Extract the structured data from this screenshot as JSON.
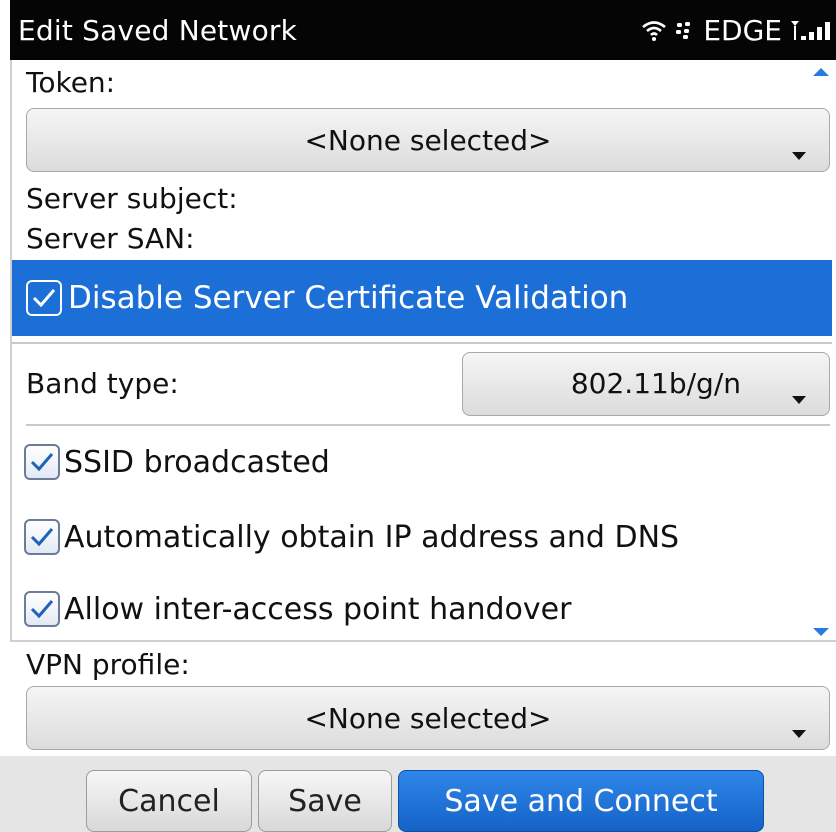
{
  "statusbar": {
    "title": "Edit Saved Network",
    "network": "EDGE",
    "icons": [
      "wifi-icon",
      "blackberry-icon",
      "signal-strength-icon"
    ]
  },
  "token": {
    "label": "Token:",
    "value": "<None selected>"
  },
  "server": {
    "subject_label": "Server subject:",
    "san_label": "Server SAN:"
  },
  "cert_validation": {
    "label": "Disable Server Certificate Validation",
    "checked": true
  },
  "band": {
    "label": "Band type:",
    "value": "802.11b/g/n"
  },
  "options": [
    {
      "label": "SSID broadcasted",
      "checked": true
    },
    {
      "label": "Automatically obtain IP address and DNS",
      "checked": true
    },
    {
      "label": "Allow inter-access point handover",
      "checked": true
    }
  ],
  "vpn": {
    "label": "VPN profile:",
    "value": "<None selected>"
  },
  "buttons": {
    "cancel": "Cancel",
    "save": "Save",
    "save_connect": "Save and Connect"
  },
  "colors": {
    "accent": "#1c6fd6",
    "statusbar": "#050505",
    "button_primary": "#1a6fd6"
  }
}
